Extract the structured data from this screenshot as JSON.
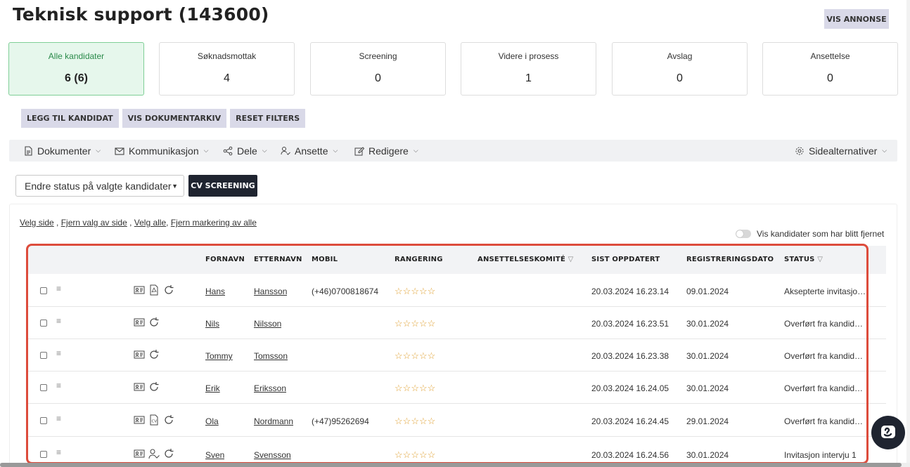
{
  "header": {
    "title": "Teknisk support (143600)",
    "vis_annonse": "VIS ANNONSE"
  },
  "stages": [
    {
      "label": "Alle kandidater",
      "count": "6 (6)",
      "active": true
    },
    {
      "label": "Søknadsmottak",
      "count": "4"
    },
    {
      "label": "Screening",
      "count": "0"
    },
    {
      "label": "Videre i prosess",
      "count": "1"
    },
    {
      "label": "Avslag",
      "count": "0"
    },
    {
      "label": "Ansettelse",
      "count": "0"
    }
  ],
  "actions": {
    "add": "LEGG TIL KANDIDAT",
    "archive": "VIS DOKUMENTARKIV",
    "reset": "RESET FILTERS"
  },
  "menu": {
    "documents": "Dokumenter",
    "communication": "Kommunikasjon",
    "share": "Dele",
    "hire": "Ansette",
    "edit": "Redigere",
    "page_options": "Sidealternativer"
  },
  "bulk": {
    "status_select": "Endre status på valgte kandidater",
    "cv_screening": "CV SCREENING"
  },
  "selection": {
    "select_page": "Velg side",
    "deselect_page": "Fjern valg av side",
    "select_all": "Velg alle",
    "deselect_all": "Fjern markering av alle"
  },
  "toggle_label": "Vis kandidater som har blitt fjernet",
  "table": {
    "headers": {
      "first": "FORNAVN",
      "last": "ETTERNAVN",
      "mobile": "MOBIL",
      "rating": "RANGERING",
      "committee": "ANSETTELSESKOMITÉ",
      "updated": "SIST OPPDATERT",
      "registered": "REGISTRERINGSDATO",
      "status": "STATUS"
    },
    "rows": [
      {
        "first": "Hans",
        "last": "Hansson",
        "mobile": "(+46)0700818674",
        "updated": "20.03.2024 16.23.14",
        "registered": "09.01.2024",
        "status": "Aksepterte invitasjon til intervju"
      },
      {
        "first": "Nils",
        "last": "Nilsson",
        "mobile": "",
        "updated": "20.03.2024 16.23.51",
        "registered": "30.01.2024",
        "status": "Overført fra kandidatbase"
      },
      {
        "first": "Tommy",
        "last": "Tomsson",
        "mobile": "",
        "updated": "20.03.2024 16.23.38",
        "registered": "30.01.2024",
        "status": "Overført fra kandidatbase"
      },
      {
        "first": "Erik",
        "last": "Eriksson",
        "mobile": "",
        "updated": "20.03.2024 16.24.05",
        "registered": "30.01.2024",
        "status": "Overført fra kandidatbase"
      },
      {
        "first": "Ola",
        "last": "Nordmann",
        "mobile": "(+47)95262694",
        "updated": "20.03.2024 16.24.45",
        "registered": "29.01.2024",
        "status": "Overført fra kandidatbase"
      },
      {
        "first": "Sven",
        "last": "Svensson",
        "mobile": "",
        "updated": "20.03.2024 16.24.56",
        "registered": "30.01.2024",
        "status": "Invitasjon intervju 1"
      }
    ]
  },
  "colors": {
    "accent": "#1f2430",
    "active_stage": "#e6f7ec",
    "highlight": "#dd4c3c",
    "star": "#e0a030"
  }
}
